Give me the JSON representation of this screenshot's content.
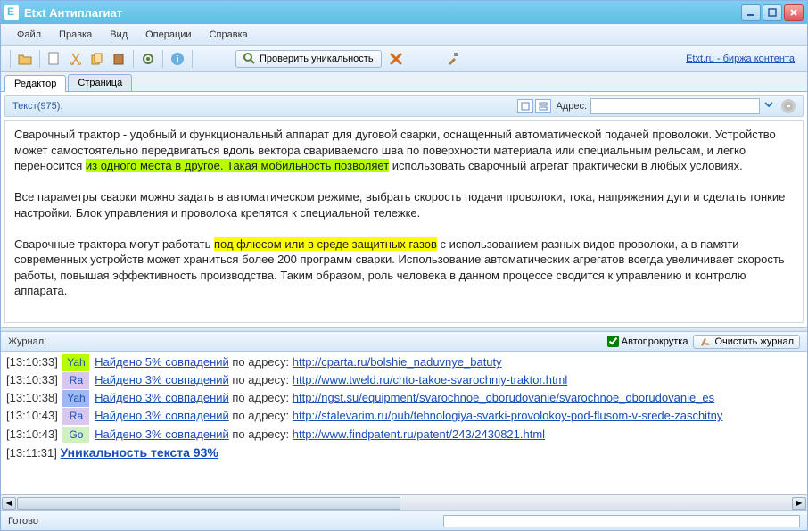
{
  "titlebar": {
    "title": "Etxt Антиплагиат"
  },
  "menubar": {
    "items": [
      "Файл",
      "Правка",
      "Вид",
      "Операции",
      "Справка"
    ]
  },
  "toolbar": {
    "check_label": "Проверить уникальность",
    "link_label": "Etxt.ru - биржа контента"
  },
  "tabs": {
    "editor": "Редактор",
    "page": "Страница"
  },
  "editor_toolbar": {
    "text_label": "Текст(975):",
    "addr_label": "Адрес:",
    "addr_value": ""
  },
  "editor_text": {
    "p1a": "Сварочный трактор - удобный и функциональный аппарат для дуговой сварки, оснащенный автоматической подачей проволоки. Устройство может самостоятельно передвигаться вдоль вектора свариваемого шва по поверхности материала или специальным рельсам, и легко переносится ",
    "p1_hl": "из одного места в другое. Такая мобильность позволяет",
    "p1b": " использовать сварочный агрегат практически в любых условиях.",
    "p2": "Все параметры сварки можно задать в автоматическом режиме, выбрать скорость подачи проволоки, тока, напряжения дуги и сделать тонкие настройки. Блок управления и проволока крепятся к специальной тележке.",
    "p3a": "Сварочные трактора могут работать ",
    "p3_hl": "под флюсом или в среде защитных газов",
    "p3b": " с использованием разных видов проволоки, а в памяти современных устройств может храниться более 200 программ сварки. Использование автоматических агрегатов всегда увеличивает скорость работы, повышая эффективность производства. Таким образом, роль человека в данном процессе сводится к управлению и контролю аппарата."
  },
  "journal": {
    "label": "Журнал:",
    "autoscroll": "Автопрокрутка",
    "clear": "Очистить журнал",
    "rows": [
      {
        "ts": "[13:10:33]",
        "engine": "Yah",
        "engine_cls": "eng-yah-g",
        "found": "Найдено 5% совпадений",
        "po": " по адресу: ",
        "url": "http://cparta.ru/bolshie_naduvnye_batuty"
      },
      {
        "ts": "[13:10:33]",
        "engine": "Ra",
        "engine_cls": "eng-ra",
        "found": "Найдено 3% совпадений",
        "po": " по адресу: ",
        "url": "http://www.tweld.ru/chto-takoe-svarochniy-traktor.html"
      },
      {
        "ts": "[13:10:38]",
        "engine": "Yah",
        "engine_cls": "eng-yah-b",
        "found": "Найдено 3% совпадений",
        "po": " по адресу: ",
        "url": "http://ngst.su/equipment/svarochnoe_oborudovanie/svarochnoe_oborudovanie_es"
      },
      {
        "ts": "[13:10:43]",
        "engine": "Ra",
        "engine_cls": "eng-ra",
        "found": "Найдено 3% совпадений",
        "po": " по адресу: ",
        "url": "http://stalevarim.ru/pub/tehnologiya-svarki-provolokoy-pod-flusom-v-srede-zaschitny"
      },
      {
        "ts": "[13:10:43]",
        "engine": "Go",
        "engine_cls": "eng-go",
        "found": "Найдено 3% совпадений",
        "po": " по адресу: ",
        "url": "http://www.findpatent.ru/patent/243/2430821.html"
      }
    ],
    "uniq_ts": "[13:11:31]",
    "uniq_text": "Уникальность текста 93%"
  },
  "status": {
    "text": "Готово"
  }
}
